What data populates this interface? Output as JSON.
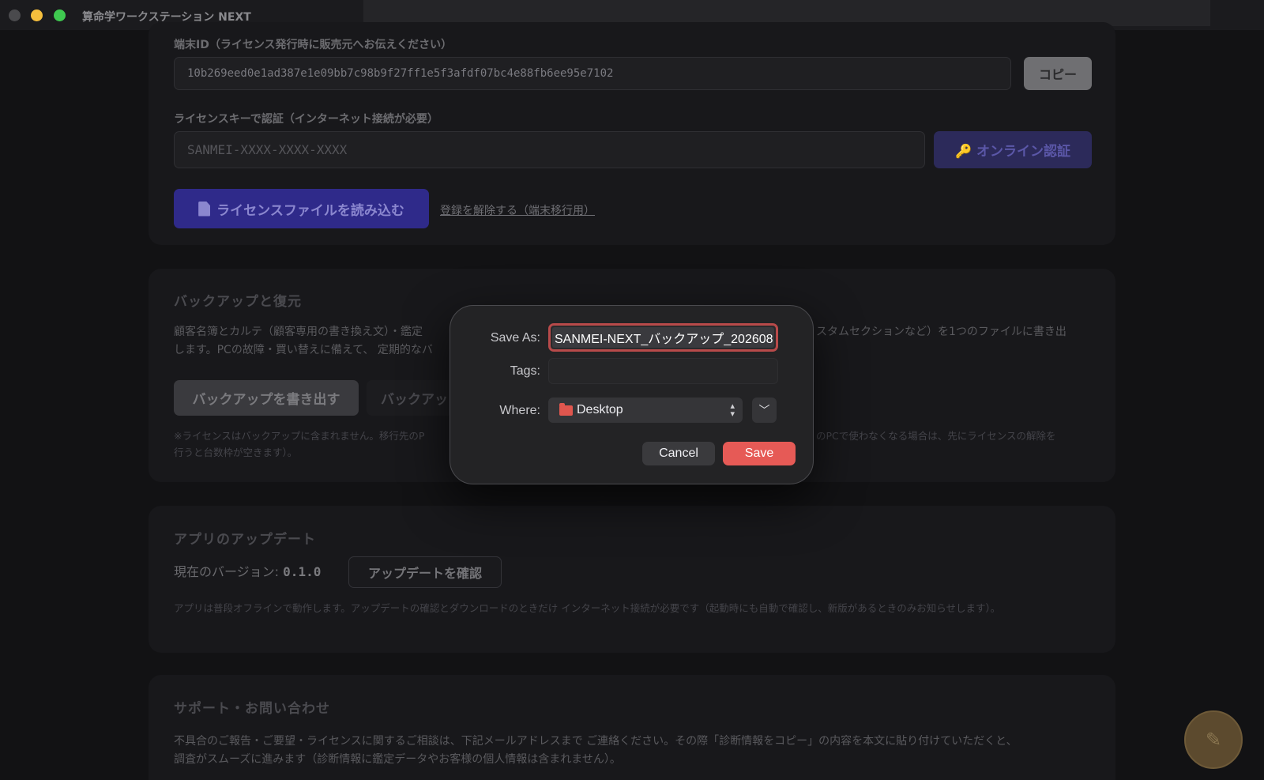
{
  "window": {
    "title": "算命学ワークステーション NEXT"
  },
  "license": {
    "device_id_label": "端末ID（ライセンス発行時に販売元へお伝えください）",
    "device_id_value": "10b269eed0e1ad387e1e09bb7c98b9f27ff1e5f3afdf07bc4e88fb6ee95e7102",
    "copy_label": "コピー",
    "key_label": "ライセンスキーで認証（インターネット接続が必要）",
    "key_placeholder": "SANMEI-XXXX-XXXX-XXXX",
    "online_auth_label": "🔑 オンライン認証",
    "load_file_icon": "document-icon",
    "load_file_label": "ライセンスファイルを読み込む",
    "unregister_link": "登録を解除する（端末移行用）"
  },
  "backup": {
    "title": "バックアップと復元",
    "description_part1": "顧客名簿とカルテ（顧客専用の書き換え文）・鑑定",
    "description_part2": "スタムセクションなど）を1つのファイルに書き出",
    "description_line2": "します。PCの故障・買い替えに備えて、 定期的なバ",
    "export_button": "バックアップを書き出す",
    "restore_button": "バックアッ",
    "note_part1": "※ライセンスはバックアップに含まれません。移行先のP",
    "note_part2": "のPCで使わなくなる場合は、先にライセンスの解除を",
    "note_line2": "行うと台数枠が空きます）。"
  },
  "update": {
    "title": "アプリのアップデート",
    "version_label": "現在のバージョン: ",
    "version_value": "0.1.0",
    "check_button": "アップデートを確認",
    "note": "アプリは普段オフラインで動作します。アップデートの確認とダウンロードのときだけ インターネット接続が必要です（起動時にも自動で確認し、新版があるときのみお知らせします）。"
  },
  "support": {
    "title": "サポート・お問い合わせ",
    "line1": "不具合のご報告・ご要望・ライセンスに関するご相談は、下記メールアドレスまで ご連絡ください。その際「診断情報をコピー」の内容を本文に貼り付けていただくと、",
    "line2": "調査がスムーズに進みます（診断情報に鑑定データやお客様の個人情報は含まれません）。"
  },
  "fab": {
    "icon": "pencil-icon",
    "glyph": "✎"
  },
  "save_dialog": {
    "save_as_label": "Save As:",
    "save_as_value": "SANMEI-NEXT_バックアップ_202608",
    "tags_label": "Tags:",
    "tags_value": "",
    "where_label": "Where:",
    "where_value": "Desktop",
    "cancel_label": "Cancel",
    "save_label": "Save"
  }
}
